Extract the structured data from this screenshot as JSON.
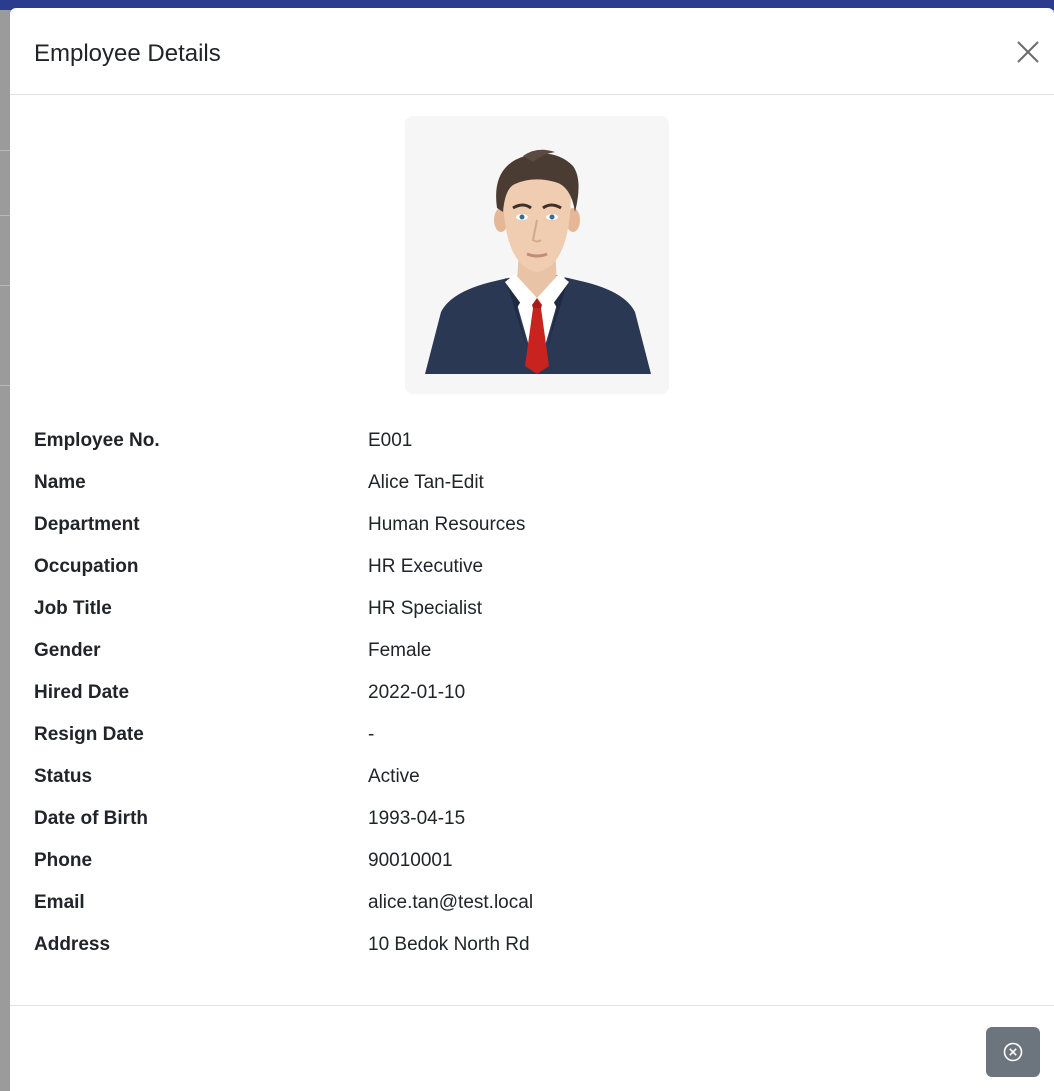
{
  "modal": {
    "title": "Employee Details"
  },
  "photo": {
    "alt": "Employee photo"
  },
  "details": [
    {
      "label": "Employee No.",
      "value": "E001"
    },
    {
      "label": "Name",
      "value": "Alice Tan-Edit"
    },
    {
      "label": "Department",
      "value": "Human Resources"
    },
    {
      "label": "Occupation",
      "value": "HR Executive"
    },
    {
      "label": "Job Title",
      "value": "HR Specialist"
    },
    {
      "label": "Gender",
      "value": "Female"
    },
    {
      "label": "Hired Date",
      "value": "2022-01-10"
    },
    {
      "label": "Resign Date",
      "value": "-"
    },
    {
      "label": "Status",
      "value": "Active"
    },
    {
      "label": "Date of Birth",
      "value": "1993-04-15"
    },
    {
      "label": "Phone",
      "value": "90010001"
    },
    {
      "label": "Email",
      "value": "alice.tan@test.local"
    },
    {
      "label": "Address",
      "value": "10 Bedok North Rd"
    }
  ],
  "icons": {
    "header_close": "close-icon",
    "footer_close": "circle-x-icon"
  },
  "colors": {
    "header_accent": "#2b3c8f",
    "footer_button": "#6c757d",
    "text": "#212529"
  }
}
